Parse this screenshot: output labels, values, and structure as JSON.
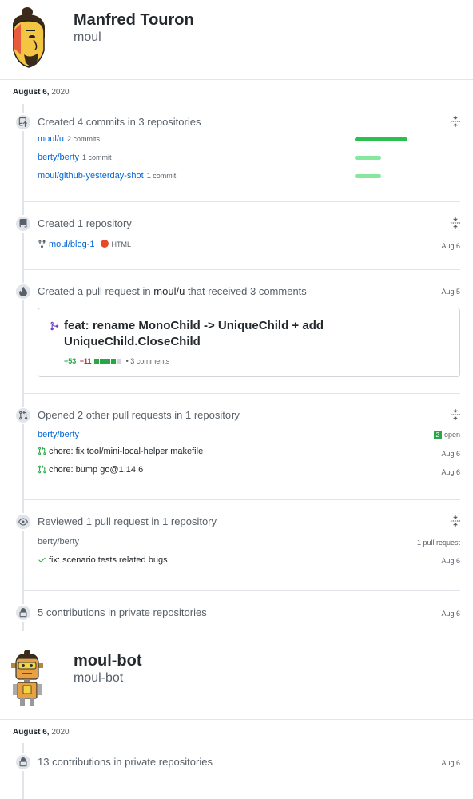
{
  "profiles": [
    {
      "name": "Manfred Touron",
      "login": "moul",
      "date_day": "August 6,",
      "date_year": "2020"
    },
    {
      "name": "moul-bot",
      "login": "moul-bot",
      "date_day": "August 6,",
      "date_year": "2020"
    }
  ],
  "commits": {
    "title": "Created 4 commits in 3 repositories",
    "repos": [
      {
        "name": "moul/u",
        "count": "2 commits",
        "share": 1.0
      },
      {
        "name": "berty/berty",
        "count": "1 commit",
        "share": 0.5
      },
      {
        "name": "moul/github-yesterday-shot",
        "count": "1 commit",
        "share": 0.5
      }
    ]
  },
  "created_repo": {
    "title": "Created 1 repository",
    "repo": "moul/blog-1",
    "language": "HTML",
    "date": "Aug 6"
  },
  "pull_request": {
    "title_prefix": "Created a pull request in",
    "repo": "moul/u",
    "title_suffix": "that received 3 comments",
    "date": "Aug 5",
    "pr_title": "feat: rename MonoChild -> UniqueChild + add UniqueChild.CloseChild",
    "additions": "+53",
    "deletions": "−11",
    "comments": "• 3 comments"
  },
  "opened_prs": {
    "title": "Opened 2 other pull requests in 1 repository",
    "repo": "berty/berty",
    "open_count": "2",
    "open_label": "open",
    "items": [
      {
        "title": "chore: fix tool/mini-local-helper makefile",
        "date": "Aug 6"
      },
      {
        "title": "chore: bump go@1.14.6",
        "date": "Aug 6"
      }
    ]
  },
  "reviewed": {
    "title": "Reviewed 1 pull request in 1 repository",
    "repo": "berty/berty",
    "count": "1 pull request",
    "item": "fix: scenario tests related bugs",
    "date": "Aug 6"
  },
  "private1": {
    "title": "5 contributions in private repositories",
    "date": "Aug 6"
  },
  "private2": {
    "title": "13 contributions in private repositories",
    "date": "Aug 6"
  }
}
